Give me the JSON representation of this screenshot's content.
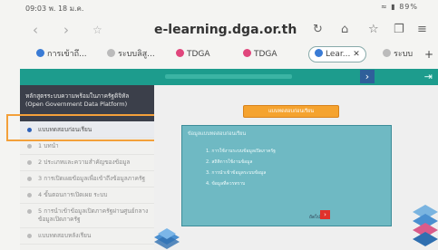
{
  "status": {
    "time": "09:03",
    "date": "พ. 18 ม.ค.",
    "battery": "89%"
  },
  "browser": {
    "url": "e-learning.dga.or.th",
    "tabs": [
      {
        "label": "การเข้าถึ...",
        "icon_color": "#3a7bd5"
      },
      {
        "label": "ระบบลิสู...",
        "icon_color": "#999999"
      },
      {
        "label": "TDGA",
        "icon_color": "#e0467c"
      },
      {
        "label": "TDGA",
        "icon_color": "#e0467c"
      },
      {
        "label": "Lear...",
        "icon_color": "#3a7bd5",
        "active": true
      },
      {
        "label": "ระบบ",
        "icon_color": "#999999"
      }
    ],
    "add_tab": "+",
    "close_tab": "✕"
  },
  "course": {
    "title": "หลักสูตรระบบความพร้อมในภาครัฐดิจิทัล (Open Government Data Platform)"
  },
  "sidebar": {
    "items": [
      {
        "label": "แบบทดสอบก่อนเรียน",
        "active": true
      },
      {
        "label": "1 บทนำ"
      },
      {
        "label": "2 ประเภทและความสำคัญของข้อมูล"
      },
      {
        "label": "3 การเปิดเผยข้อมูลเพื่อเข้าถึงข้อมูลภาครัฐ"
      },
      {
        "label": "4 ขั้นตอนการเปิดเผย ระบบ"
      },
      {
        "label": "5 การนำเข้าข้อมูลเปิดภาครัฐผ่านศูนย์กลางข้อมูลเปิดภาครัฐ"
      },
      {
        "label": "แบบทดสอบหลังเรียน"
      }
    ]
  },
  "content": {
    "button_label": "แบบทดสอบก่อนเรียน",
    "panel_title": "ข้อมูลแบบทดสอบก่อนเรียน",
    "panel_items": [
      "1. การใช้งานระบบข้อมูลเปิดภาครัฐ",
      "2. สถิติการใช้งานข้อมูล",
      "3. การนำเข้าข้อมูลระบบข้อมูล",
      "4. ข้อมูลที่ควรทราบ"
    ],
    "next_label": "ถัดไป",
    "next_icon": "›"
  },
  "colors": {
    "accent": "#1d9c8d",
    "highlight": "#f3a03a",
    "button": "#f5a32f"
  }
}
